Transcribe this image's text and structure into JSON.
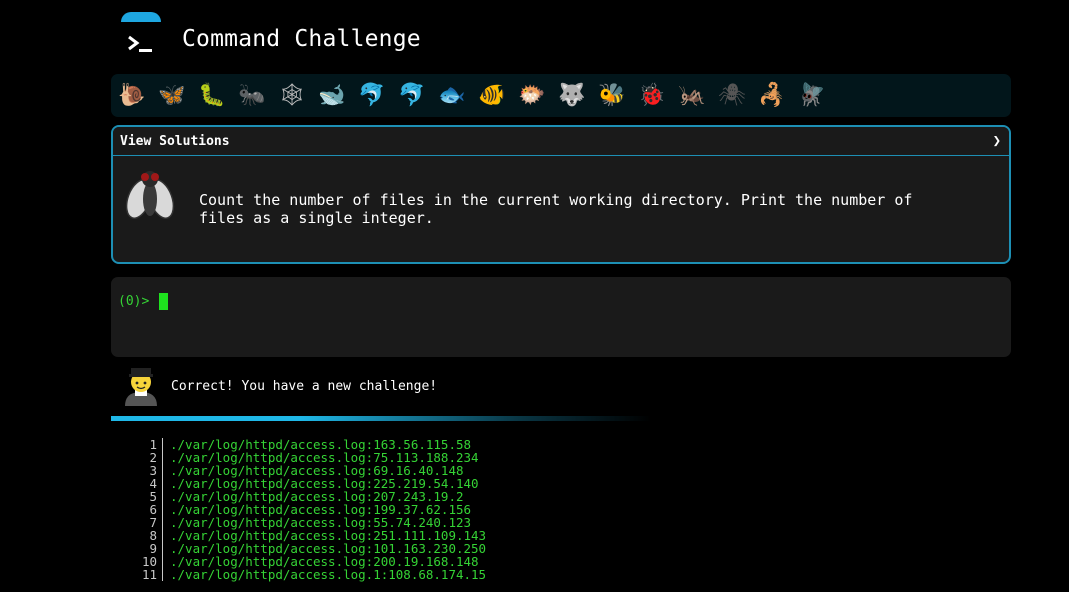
{
  "header": {
    "title": "Command Challenge"
  },
  "levels": [
    {
      "name": "snail-icon",
      "glyph": "🐌",
      "color": "#8b6a3e"
    },
    {
      "name": "butterfly-icon",
      "glyph": "🦋",
      "color": "#e07b24"
    },
    {
      "name": "caterpillar-icon",
      "glyph": "🐛",
      "color": "#4caf50"
    },
    {
      "name": "ant-icon",
      "glyph": "🐜",
      "color": "#8d5524"
    },
    {
      "name": "spider-web-icon",
      "glyph": "🕸",
      "color": "#bbbbbb"
    },
    {
      "name": "whale-icon",
      "glyph": "🐋",
      "color": "#4aa3df"
    },
    {
      "name": "dolphin-icon",
      "glyph": "🐬",
      "color": "#4aa3df"
    },
    {
      "name": "shark-icon",
      "glyph": "🐬",
      "color": "#a0b4c0"
    },
    {
      "name": "fish-icon",
      "glyph": "🐟",
      "color": "#3b9fe0"
    },
    {
      "name": "tropical-fish-icon",
      "glyph": "🐠",
      "color": "#f2c12e"
    },
    {
      "name": "blowfish-icon",
      "glyph": "🐡",
      "color": "#c49a5a"
    },
    {
      "name": "wolf-icon",
      "glyph": "🐺",
      "color": "#9e9e9e"
    },
    {
      "name": "bee-icon",
      "glyph": "🐝",
      "color": "#f2d22e"
    },
    {
      "name": "ladybug-icon",
      "glyph": "🐞",
      "color": "#e03b3b"
    },
    {
      "name": "cricket-icon",
      "glyph": "🦗",
      "color": "#7cc142"
    },
    {
      "name": "spider-icon",
      "glyph": "🕷",
      "color": "#555555"
    },
    {
      "name": "scorpion-icon",
      "glyph": "🦂",
      "color": "#d0392b"
    },
    {
      "name": "fly-icon",
      "glyph": "🪰",
      "color": "#dddddd"
    }
  ],
  "challenge": {
    "solutions_label": "View Solutions",
    "chevron": "❯",
    "description": "Count the number of files in the current working directory. Print the number of\nfiles as a single integer."
  },
  "terminal": {
    "prompt": "(0)>"
  },
  "feedback": {
    "message": "Correct! You have a new challenge!"
  },
  "output": {
    "lines": [
      {
        "n": "1",
        "text": "./var/log/httpd/access.log:163.56.115.58"
      },
      {
        "n": "2",
        "text": "./var/log/httpd/access.log:75.113.188.234"
      },
      {
        "n": "3",
        "text": "./var/log/httpd/access.log:69.16.40.148"
      },
      {
        "n": "4",
        "text": "./var/log/httpd/access.log:225.219.54.140"
      },
      {
        "n": "5",
        "text": "./var/log/httpd/access.log:207.243.19.2"
      },
      {
        "n": "6",
        "text": "./var/log/httpd/access.log:199.37.62.156"
      },
      {
        "n": "7",
        "text": "./var/log/httpd/access.log:55.74.240.123"
      },
      {
        "n": "8",
        "text": "./var/log/httpd/access.log:251.111.109.143"
      },
      {
        "n": "9",
        "text": "./var/log/httpd/access.log:101.163.230.250"
      },
      {
        "n": "10",
        "text": "./var/log/httpd/access.log:200.19.168.148"
      },
      {
        "n": "11",
        "text": "./var/log/httpd/access.log.1:108.68.174.15"
      }
    ]
  },
  "colors": {
    "accent": "#1d8fb4",
    "terminal_green": "#35d335",
    "panel_bg": "#1a1a1a",
    "level_bar_bg": "#02161b"
  }
}
